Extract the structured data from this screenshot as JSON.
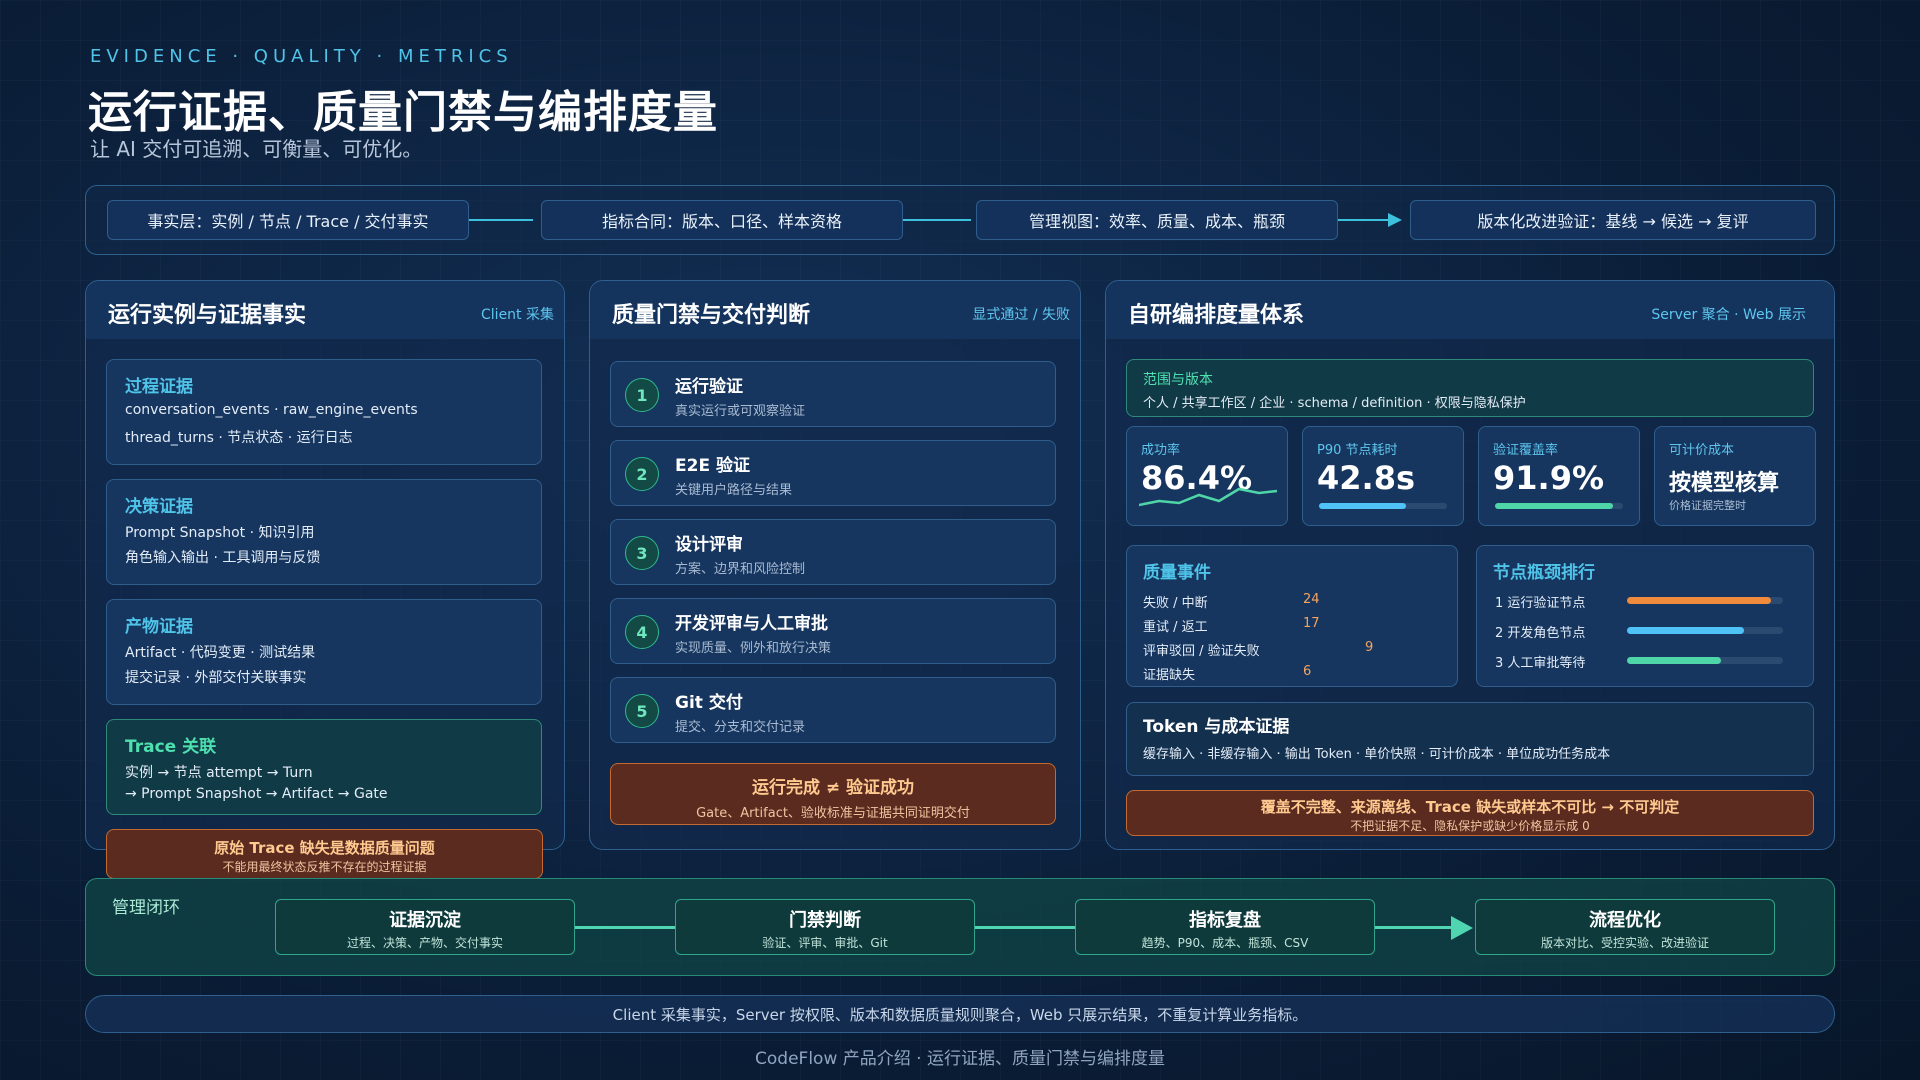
{
  "header": {
    "eyebrow": "EVIDENCE · QUALITY · METRICS",
    "title": "运行证据、质量门禁与编排度量",
    "subtitle": "让 AI 交付可追溯、可衡量、可优化。"
  },
  "pipeline": [
    "事实层：实例 / 节点 / Trace / 交付事实",
    "指标合同：版本、口径、样本资格",
    "管理视图：效率、质量、成本、瓶颈",
    "版本化改进验证：基线 → 候选 → 复评"
  ],
  "evidence_panel": {
    "title": "运行实例与证据事实",
    "tag": "Client 采集",
    "cards": [
      {
        "title": "过程证据",
        "lines": [
          "conversation_events · raw_engine_events",
          "thread_turns · 节点状态 · 运行日志"
        ]
      },
      {
        "title": "决策证据",
        "lines": [
          "Prompt Snapshot · 知识引用",
          "角色输入输出 · 工具调用与反馈"
        ]
      },
      {
        "title": "产物证据",
        "lines": [
          "Artifact · 代码变更 · 测试结果",
          "提交记录 · 外部交付关联事实"
        ]
      },
      {
        "title": "Trace 关联",
        "lines": [
          "实例 → 节点 attempt → Turn",
          "→ Prompt Snapshot → Artifact → Gate"
        ]
      }
    ],
    "warning": {
      "main": "原始 Trace 缺失是数据质量问题",
      "sub": "不能用最终状态反推不存在的过程证据"
    }
  },
  "gate_panel": {
    "title": "质量门禁与交付判断",
    "tag": "显式通过 / 失败",
    "gates": [
      {
        "num": "1",
        "title": "运行验证",
        "sub": "真实运行或可观察验证"
      },
      {
        "num": "2",
        "title": "E2E 验证",
        "sub": "关键用户路径与结果"
      },
      {
        "num": "3",
        "title": "设计评审",
        "sub": "方案、边界和风险控制"
      },
      {
        "num": "4",
        "title": "开发评审与人工审批",
        "sub": "实现质量、例外和放行决策"
      },
      {
        "num": "5",
        "title": "Git 交付",
        "sub": "提交、分支和交付记录"
      }
    ],
    "warning": {
      "main": "运行完成 ≠ 验证成功",
      "sub": "Gate、Artifact、验收标准与证据共同证明交付"
    }
  },
  "metrics_panel": {
    "title": "自研编排度量体系",
    "tag": "Server 聚合 · Web 展示",
    "scope": {
      "title": "范围与版本",
      "desc": "个人 / 共享工作区 / 企业 · schema / definition · 权限与隐私保护"
    },
    "kpis": [
      {
        "label": "成功率",
        "value": "86.4%"
      },
      {
        "label": "P90 节点耗时",
        "value": "42.8s",
        "bar": 0.68,
        "color": "#4fc3f7"
      },
      {
        "label": "验证覆盖率",
        "value": "91.9%",
        "bar": 0.92,
        "color": "#4fd6a8"
      },
      {
        "label": "可计价成本",
        "value": "按模型核算",
        "sub": "价格证据完整时"
      }
    ],
    "quality_events": {
      "title": "质量事件",
      "rows": [
        {
          "label": "失败 / 中断",
          "value": "24"
        },
        {
          "label": "重试 / 返工",
          "value": "17"
        },
        {
          "label": "评审驳回 / 验证失败",
          "value": "9"
        },
        {
          "label": "证据缺失",
          "value": "6"
        }
      ]
    },
    "bottlenecks": {
      "title": "节点瓶颈排行",
      "rows": [
        {
          "label": "1 运行验证节点",
          "level": 0.92,
          "color": "#f08a3c"
        },
        {
          "label": "2 开发角色节点",
          "level": 0.75,
          "color": "#4fc3f7"
        },
        {
          "label": "3 人工审批等待",
          "level": 0.6,
          "color": "#4fd6a8"
        }
      ]
    },
    "token": {
      "title": "Token 与成本证据",
      "desc": "缓存输入 · 非缓存输入 · 输出 Token · 单价快照 · 可计价成本 · 单位成功任务成本"
    },
    "warning": {
      "main": "覆盖不完整、来源离线、Trace 缺失或样本不可比 → 不可判定",
      "sub": "不把证据不足、隐私保护或缺少价格显示成 0"
    }
  },
  "loop": {
    "label": "管理闭环",
    "steps": [
      {
        "title": "证据沉淀",
        "sub": "过程、决策、产物、交付事实"
      },
      {
        "title": "门禁判断",
        "sub": "验证、评审、审批、Git"
      },
      {
        "title": "指标复盘",
        "sub": "趋势、P90、成本、瓶颈、CSV"
      },
      {
        "title": "流程优化",
        "sub": "版本对比、受控实验、改进验证"
      }
    ]
  },
  "note": "Client 采集事实，Server 按权限、版本和数据质量规则聚合，Web 只展示结果，不重复计算业务指标。",
  "footer": "CodeFlow 产品介绍 · 运行证据、质量门禁与编排度量"
}
